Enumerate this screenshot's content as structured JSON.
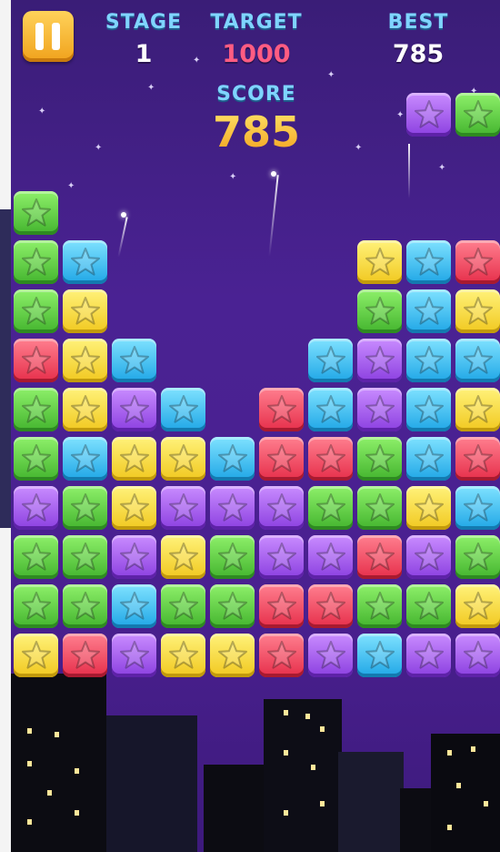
{
  "hud": {
    "stage_label": "STAGE",
    "stage_value": "1",
    "target_label": "TARGET",
    "target_value": "1000",
    "best_label": "BEST",
    "best_value": "785",
    "score_label": "SCORE",
    "score_value": "785"
  },
  "colors": {
    "label": "#7fd4ff",
    "target_value": "#ff5c82",
    "white_value": "#ffffff",
    "score": "#ffc93a",
    "background": "#4a2293"
  },
  "pause_button": {
    "icon": "pause-icon"
  },
  "board": {
    "columns": 10,
    "rows": 10,
    "grid": [
      [
        null,
        null,
        null,
        null,
        null,
        null,
        null,
        null,
        "purple",
        "green"
      ],
      [
        null,
        null,
        null,
        null,
        null,
        null,
        null,
        null,
        null,
        null
      ],
      [
        "green",
        null,
        null,
        null,
        null,
        null,
        null,
        null,
        null,
        null
      ],
      [
        "green",
        "blue",
        null,
        null,
        null,
        null,
        null,
        "yellow",
        "blue",
        "red"
      ],
      [
        "green",
        "yellow",
        null,
        null,
        null,
        null,
        null,
        "green",
        "blue",
        "yellow"
      ],
      [
        "red",
        "yellow",
        "blue",
        null,
        null,
        null,
        "blue",
        "purple",
        "blue",
        "blue"
      ],
      [
        "green",
        "yellow",
        "purple",
        "blue",
        null,
        "red",
        "blue",
        "purple",
        "blue",
        "yellow"
      ],
      [
        "green",
        "blue",
        "yellow",
        "yellow",
        "blue",
        "red",
        "red",
        "green",
        "blue",
        "red"
      ],
      [
        "purple",
        "green",
        "yellow",
        "purple",
        "purple",
        "purple",
        "green",
        "green",
        "yellow",
        "blue"
      ],
      [
        "green",
        "green",
        "purple",
        "yellow",
        "green",
        "purple",
        "purple",
        "red",
        "purple",
        "green"
      ],
      [
        "green",
        "green",
        "blue",
        "green",
        "green",
        "red",
        "red",
        "green",
        "green",
        "yellow"
      ],
      [
        "yellow",
        "red",
        "purple",
        "yellow",
        "yellow",
        "red",
        "purple",
        "blue",
        "purple",
        "purple"
      ]
    ],
    "tile_icon": "star-icon"
  }
}
